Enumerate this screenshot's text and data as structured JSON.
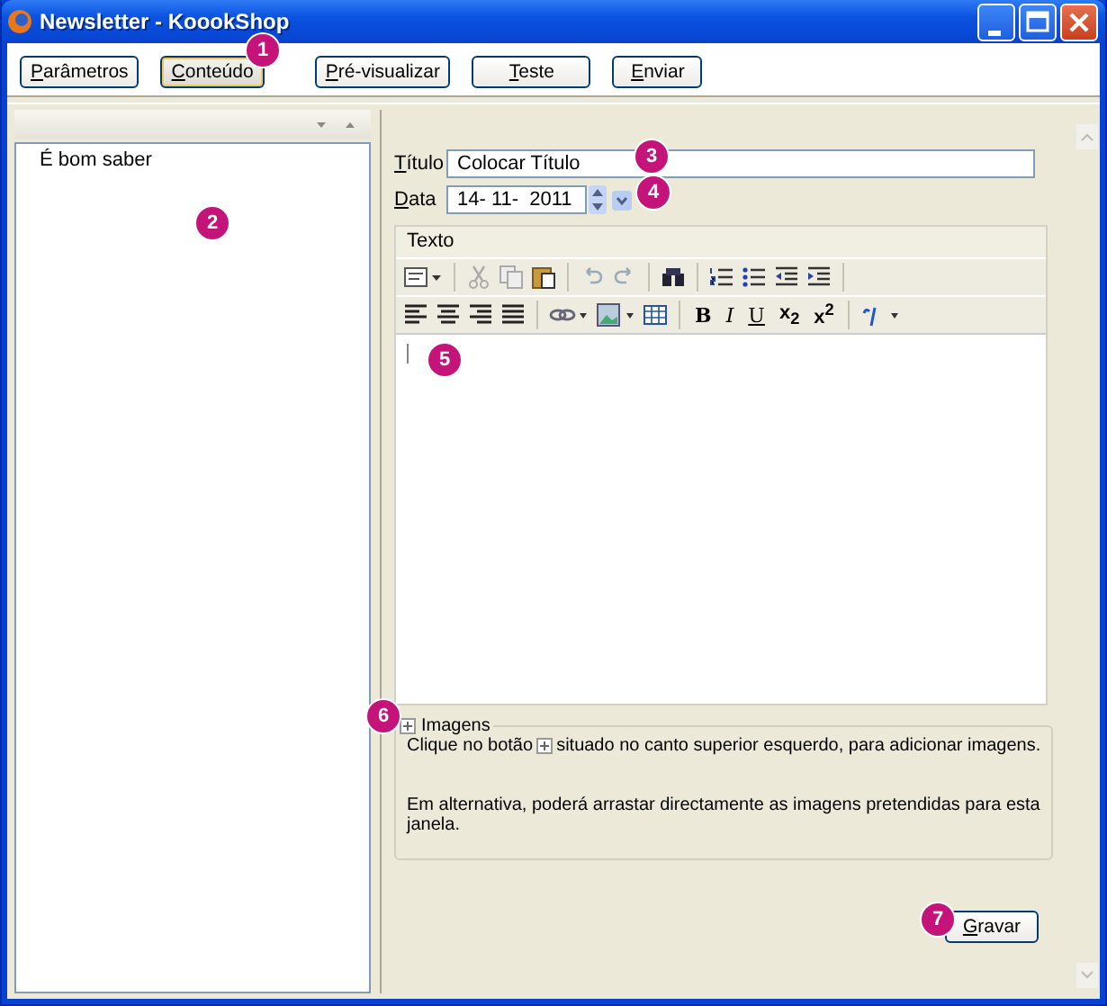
{
  "window": {
    "title": "Newsletter - KoookShop"
  },
  "toolbar": {
    "buttons": [
      {
        "label": "Parâmetros",
        "selected": false
      },
      {
        "label": "Conteúdo",
        "selected": true
      },
      {
        "label": "Pré-visualizar",
        "selected": false
      },
      {
        "label": "Teste",
        "selected": false
      },
      {
        "label": "Enviar",
        "selected": false
      }
    ]
  },
  "list": {
    "items": [
      {
        "label": "É bom saber"
      }
    ]
  },
  "form": {
    "title_label": "Título",
    "title_value": "Colocar Título",
    "date_label": "Data",
    "date_value": "14- 11-  2011"
  },
  "editor": {
    "label": "Texto",
    "format_buttons": [
      {
        "label": "B"
      },
      {
        "label": "I"
      },
      {
        "label": "U"
      },
      {
        "label": "x$_{2}$"
      },
      {
        "label": "x$^{2}$"
      }
    ]
  },
  "images": {
    "title": "Imagens",
    "expanded": false,
    "text_before": "Clique no botão",
    "text_after": "situado no canto superior esquerdo, para adicionar imagens.",
    "note": "Em alternativa, poderá arrastar directamente as imagens pretendidas para esta janela."
  },
  "save_button": "Gravar",
  "callouts": [
    {
      "label": "1"
    },
    {
      "label": "2"
    },
    {
      "label": "3"
    },
    {
      "label": "4"
    },
    {
      "label": "5"
    },
    {
      "label": "6"
    },
    {
      "label": "7"
    }
  ]
}
